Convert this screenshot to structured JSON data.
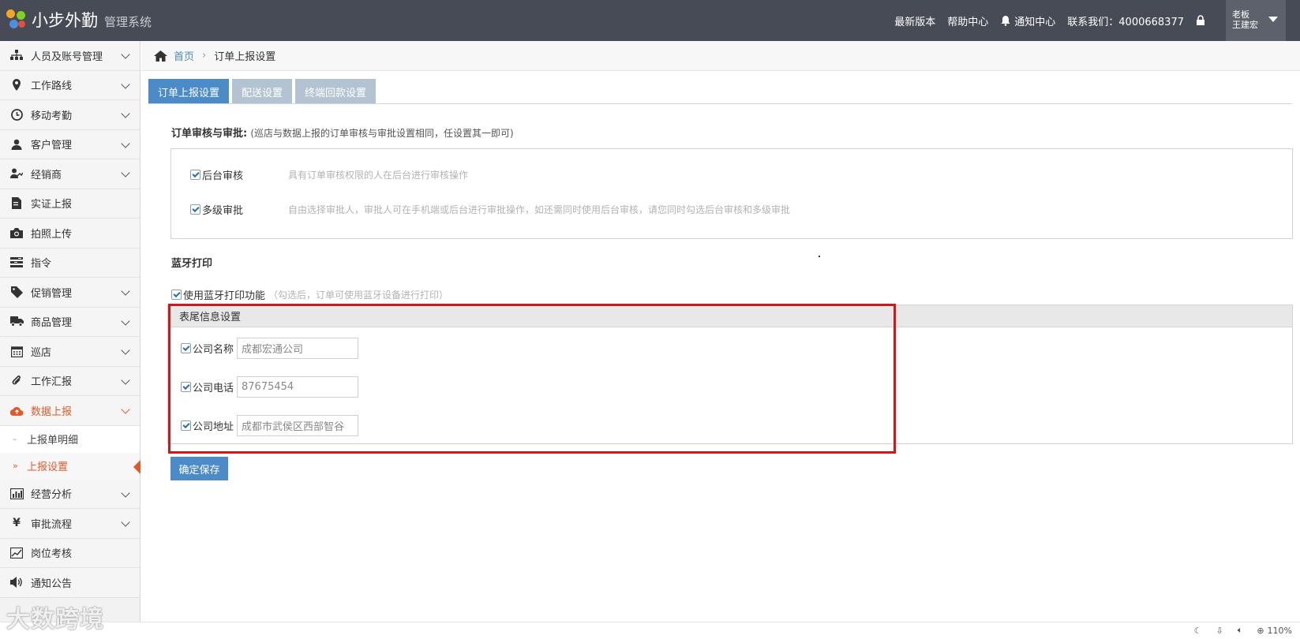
{
  "header": {
    "brand_name": "小步外勤",
    "brand_sub": "管理系统",
    "links": {
      "latest_version": "最新版本",
      "help_center": "帮助中心",
      "notify_center": "通知中心",
      "contact": "联系我们：4000668377"
    },
    "user": {
      "role": "老板",
      "name": "王建宏"
    }
  },
  "sidebar": {
    "items": [
      {
        "label": "人员及账号管理",
        "icon": "org-chart-icon",
        "expandable": true
      },
      {
        "label": "工作路线",
        "icon": "map-marker-icon",
        "expandable": true
      },
      {
        "label": "移动考勤",
        "icon": "clock-icon",
        "expandable": true
      },
      {
        "label": "客户管理",
        "icon": "user-icon",
        "expandable": true
      },
      {
        "label": "经销商",
        "icon": "dealer-icon",
        "expandable": true
      },
      {
        "label": "实证上报",
        "icon": "report-doc-icon",
        "expandable": false
      },
      {
        "label": "拍照上传",
        "icon": "camera-icon",
        "expandable": false
      },
      {
        "label": "指令",
        "icon": "tasks-icon",
        "expandable": false
      },
      {
        "label": "促销管理",
        "icon": "tag-icon",
        "expandable": true
      },
      {
        "label": "商品管理",
        "icon": "truck-icon",
        "expandable": true
      },
      {
        "label": "巡店",
        "icon": "calendar-icon",
        "expandable": true
      },
      {
        "label": "工作汇报",
        "icon": "paperclip-icon",
        "expandable": true
      },
      {
        "label": "数据上报",
        "icon": "cloud-upload-icon",
        "expandable": true
      }
    ],
    "sub_items": [
      {
        "label": "上报单明细"
      },
      {
        "label": "上报设置"
      }
    ],
    "items_after": [
      {
        "label": "经营分析",
        "icon": "bar-chart-icon",
        "expandable": true
      },
      {
        "label": "审批流程",
        "icon": "yen-icon",
        "expandable": true
      },
      {
        "label": "岗位考核",
        "icon": "line-chart-icon",
        "expandable": false
      },
      {
        "label": "通知公告",
        "icon": "volume-icon",
        "expandable": false
      }
    ]
  },
  "breadcrumb": {
    "home": "首页",
    "current": "订单上报设置"
  },
  "tabs": [
    "订单上报设置",
    "配送设置",
    "终端回款设置"
  ],
  "review": {
    "title": "订单审核与审批:",
    "note": "(巡店与数据上报的订单审核与审批设置相同，任设置其一即可)",
    "options": [
      {
        "label": "后台审核",
        "desc": "具有订单审核权限的人在后台进行审核操作",
        "checked": true
      },
      {
        "label": "多级审批",
        "desc": "自由选择审批人，审批人可在手机端或后台进行审批操作，如还需同时使用后台审核，请您同时勾选后台审核和多级审批",
        "checked": true
      }
    ]
  },
  "bluetooth": {
    "title": "蓝牙打印",
    "option_label": "使用蓝牙打印功能",
    "option_note": "（勾选后，订单可使用蓝牙设备进行打印）",
    "checked": true
  },
  "footer_panel": {
    "title": "表尾信息设置",
    "fields": [
      {
        "label": "公司名称",
        "value": "成都宏通公司",
        "checked": true
      },
      {
        "label": "公司电话",
        "value": "87675454",
        "checked": true
      },
      {
        "label": "公司地址",
        "value": "成都市武侯区西部智谷",
        "checked": true
      }
    ]
  },
  "save_label": "确定保存",
  "statusbar": {
    "zoom": "110%"
  },
  "watermark": "大数跨境",
  "colors": {
    "topbar": "#474b55",
    "accent_blue": "#4a8bc8",
    "active_orange": "#e05a2b",
    "highlight_red": "#d5151c"
  }
}
